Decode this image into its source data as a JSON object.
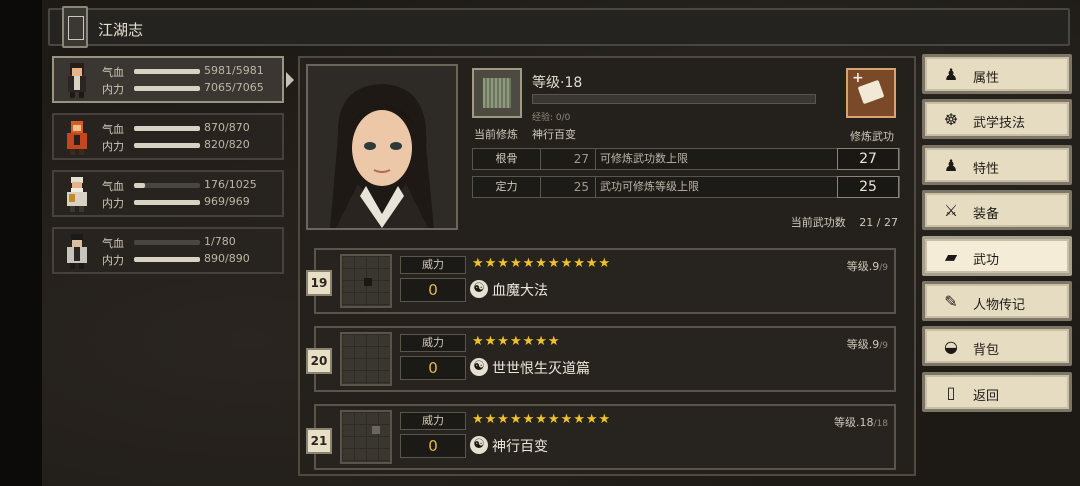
{
  "title": "江湖志",
  "party": [
    {
      "hp_label": "气血",
      "mp_label": "内力",
      "hp": "5981/5981",
      "mp": "7065/7065",
      "hp_fill": 1.0,
      "mp_fill": 1.0,
      "selected": true,
      "color": "#b65c2f"
    },
    {
      "hp_label": "气血",
      "mp_label": "内力",
      "hp": "870/870",
      "mp": "820/820",
      "hp_fill": 1.0,
      "mp_fill": 1.0,
      "selected": false,
      "color": "#d85a24"
    },
    {
      "hp_label": "气血",
      "mp_label": "内力",
      "hp": "176/1025",
      "mp": "969/969",
      "hp_fill": 0.17,
      "mp_fill": 1.0,
      "selected": false,
      "color": "#e6e0d2"
    },
    {
      "hp_label": "气血",
      "mp_label": "内力",
      "hp": "1/780",
      "mp": "890/890",
      "hp_fill": 0.0,
      "mp_fill": 1.0,
      "selected": false,
      "color": "#c8c4bc"
    }
  ],
  "cultivation": {
    "level_text": "等级·18",
    "exp_text": "经验: 0/0",
    "current_label": "当前修炼",
    "current_skill": "神行百变",
    "practice_label": "修炼武功",
    "stats": [
      {
        "name": "根骨",
        "value": "27",
        "desc": "可修炼武功数上限",
        "cap": "27"
      },
      {
        "name": "定力",
        "value": "25",
        "desc": "武功可修炼等级上限",
        "cap": "25"
      }
    ],
    "count_label": "当前武功数",
    "count_value": "21 / 27"
  },
  "skills": [
    {
      "num": "19",
      "power_label": "威力",
      "power": "0",
      "stars": 11,
      "star_glyphs": "★★★★★★★★★★★",
      "name": "血魔大法",
      "level": "等级.9",
      "max": "/9"
    },
    {
      "num": "20",
      "power_label": "威力",
      "power": "0",
      "stars": 7,
      "star_glyphs": "★★★★★★★",
      "name": "世世恨生灭道篇",
      "level": "等级.9",
      "max": "/9"
    },
    {
      "num": "21",
      "power_label": "威力",
      "power": "0",
      "stars": 11,
      "star_glyphs": "★★★★★★★★★★★",
      "name": "神行百变",
      "level": "等级.18",
      "max": "/18"
    }
  ],
  "menu": [
    {
      "label": "属性",
      "icon": "person-icon",
      "glyph": "♟"
    },
    {
      "label": "武学技法",
      "icon": "martial-person-icon",
      "glyph": "☸"
    },
    {
      "label": "特性",
      "icon": "trait-icon",
      "glyph": "♟"
    },
    {
      "label": "装备",
      "icon": "sword-icon",
      "glyph": "⚔"
    },
    {
      "label": "武功",
      "icon": "book-icon",
      "glyph": "▰"
    },
    {
      "label": "人物传记",
      "icon": "scroll-icon",
      "glyph": "✎"
    },
    {
      "label": "背包",
      "icon": "bag-icon",
      "glyph": "◒"
    },
    {
      "label": "返回",
      "icon": "door-icon",
      "glyph": "▯"
    }
  ],
  "active_menu": "武功",
  "colors": {
    "star": "#f0c22a",
    "power": "#e8b84a",
    "panel": "#24211d",
    "menu_bg": "#e6dcc2"
  }
}
